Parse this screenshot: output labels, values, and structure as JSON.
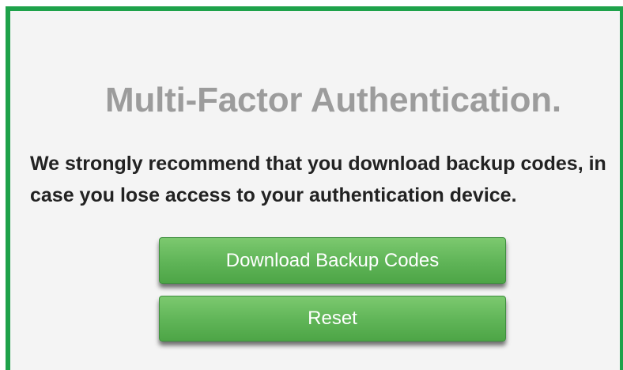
{
  "page": {
    "title": "Multi-Factor Authentication.",
    "message": "We strongly recommend that you download backup codes, in case you lose access to your authentication device."
  },
  "buttons": {
    "download_label": "Download Backup Codes",
    "reset_label": "Reset"
  },
  "colors": {
    "border": "#1ea24a",
    "button": "#5fb457",
    "title": "#9c9c9c",
    "background": "#f4f4f4"
  }
}
